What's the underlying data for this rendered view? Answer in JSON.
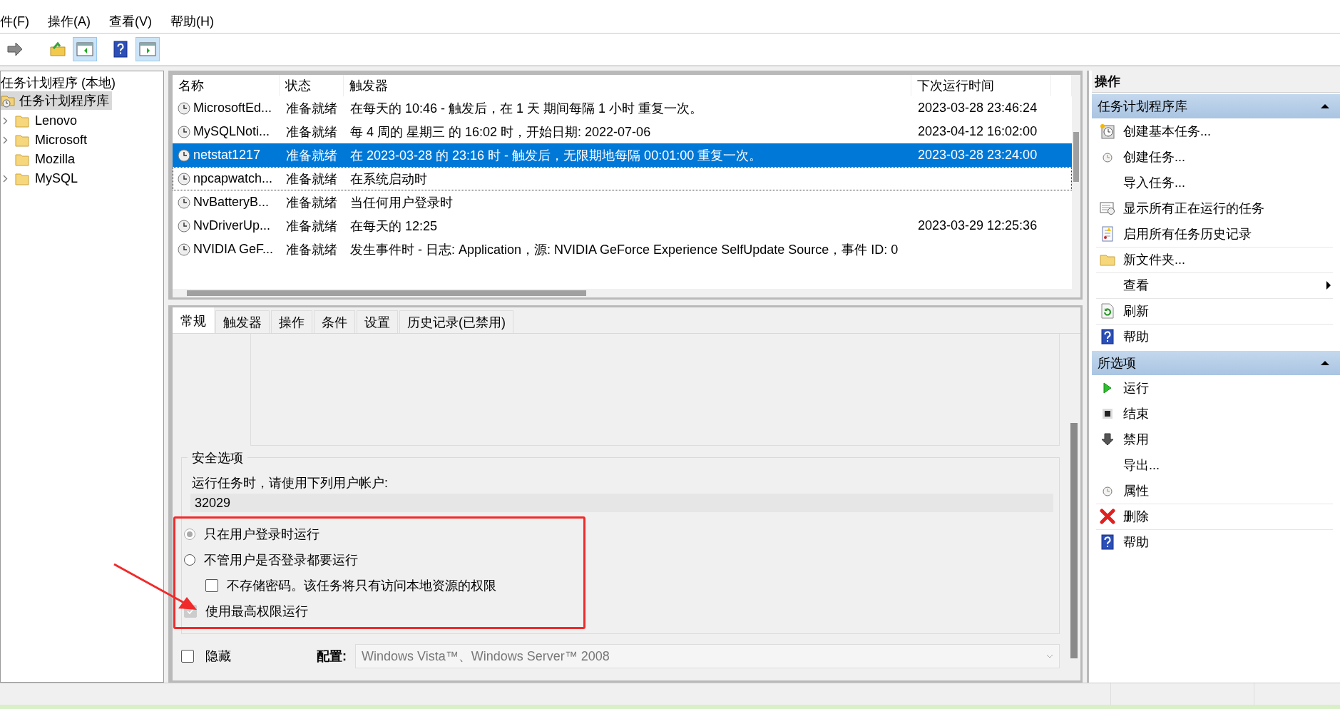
{
  "menu": [
    "件(F)",
    "操作(A)",
    "查看(V)",
    "帮助(H)"
  ],
  "toolbar": [
    {
      "kind": "forward",
      "selected": false
    },
    {
      "kind": "folder-up",
      "selected": false
    },
    {
      "kind": "pane-left",
      "selected": true
    },
    {
      "kind": "help",
      "selected": false
    },
    {
      "kind": "pane-right",
      "selected": true
    }
  ],
  "tree": {
    "root": "任务计划程序 (本地)",
    "library": {
      "label": "任务计划程序库",
      "selected": true
    },
    "children": [
      {
        "label": "Lenovo",
        "expandable": true
      },
      {
        "label": "Microsoft",
        "expandable": true
      },
      {
        "label": "Mozilla",
        "expandable": false
      },
      {
        "label": "MySQL",
        "expandable": true
      }
    ]
  },
  "table": {
    "columns": [
      "名称",
      "状态",
      "触发器",
      "下次运行时间"
    ],
    "rows": [
      {
        "name": "MicrosoftEd...",
        "status": "准备就绪",
        "trigger": "在每天的 10:46 - 触发后，在 1 天 期间每隔 1 小时 重复一次。",
        "next": "2023-03-28 23:46:24",
        "selected": false,
        "focused": false
      },
      {
        "name": "MySQLNoti...",
        "status": "准备就绪",
        "trigger": "每 4 周的 星期三 的 16:02 时，开始日期: 2022-07-06",
        "next": "2023-04-12 16:02:00",
        "selected": false,
        "focused": false
      },
      {
        "name": "netstat1217",
        "status": "准备就绪",
        "trigger": "在 2023-03-28 的 23:16 时 - 触发后，无限期地每隔 00:01:00 重复一次。",
        "next": "2023-03-28 23:24:00",
        "selected": true,
        "focused": false
      },
      {
        "name": "npcapwatch...",
        "status": "准备就绪",
        "trigger": "在系统启动时",
        "next": "",
        "selected": false,
        "focused": true
      },
      {
        "name": "NvBatteryB...",
        "status": "准备就绪",
        "trigger": "当任何用户登录时",
        "next": "",
        "selected": false,
        "focused": false
      },
      {
        "name": "NvDriverUp...",
        "status": "准备就绪",
        "trigger": "在每天的 12:25",
        "next": "2023-03-29 12:25:36",
        "selected": false,
        "focused": false
      },
      {
        "name": "NVIDIA GeF...",
        "status": "准备就绪",
        "trigger": "发生事件时 - 日志: Application，源: NVIDIA GeForce Experience SelfUpdate Source，事件 ID: 0",
        "next": "",
        "selected": false,
        "focused": false
      }
    ]
  },
  "detail": {
    "tabs": [
      {
        "label": "常规",
        "selected": true
      },
      {
        "label": "触发器",
        "selected": false
      },
      {
        "label": "操作",
        "selected": false
      },
      {
        "label": "条件",
        "selected": false
      },
      {
        "label": "设置",
        "selected": false
      },
      {
        "label": "历史记录(已禁用)",
        "selected": false
      }
    ],
    "security": {
      "title": "安全选项",
      "account_label": "运行任务时，请使用下列用户帐户:",
      "account": "32029",
      "options": [
        {
          "kind": "radio",
          "label": "只在用户登录时运行",
          "checked": true,
          "disabled": true,
          "indented": false
        },
        {
          "kind": "radio",
          "label": "不管用户是否登录都要运行",
          "checked": false,
          "disabled": false,
          "indented": false
        },
        {
          "kind": "checkbox",
          "label": "不存储密码。该任务将只有访问本地资源的权限",
          "checked": false,
          "disabled": false,
          "indented": true
        },
        {
          "kind": "checkbox",
          "label": "使用最高权限运行",
          "checked": true,
          "disabled": true,
          "indented": false
        }
      ]
    },
    "hidden": {
      "label": "隐藏",
      "checked": false
    },
    "config": {
      "label": "配置:",
      "value": "Windows Vista™、Windows Server™ 2008"
    }
  },
  "annotation": {
    "highlight_options": true,
    "arrow": true
  },
  "actions": {
    "title": "操作",
    "sections": [
      {
        "title": "任务计划程序库",
        "items": [
          {
            "label": "创建基本任务...",
            "kind": "clock-new",
            "rule": false,
            "submenu": false
          },
          {
            "label": "创建任务...",
            "kind": "clock",
            "rule": false,
            "submenu": false
          },
          {
            "label": "导入任务...",
            "kind": "plain",
            "rule": false,
            "submenu": false
          },
          {
            "label": "显示所有正在运行的任务",
            "kind": "list",
            "rule": false,
            "submenu": false
          },
          {
            "label": "启用所有任务历史记录",
            "kind": "log",
            "rule": false,
            "submenu": false
          },
          {
            "label": "新文件夹...",
            "kind": "folder",
            "rule": true,
            "submenu": false
          },
          {
            "label": "查看",
            "kind": "plain",
            "rule": true,
            "submenu": true
          },
          {
            "label": "刷新",
            "kind": "refresh",
            "rule": true,
            "submenu": false
          },
          {
            "label": "帮助",
            "kind": "help",
            "rule": true,
            "submenu": false
          }
        ]
      },
      {
        "title": "所选项",
        "items": [
          {
            "label": "运行",
            "kind": "play",
            "rule": false,
            "submenu": false
          },
          {
            "label": "结束",
            "kind": "stop",
            "rule": false,
            "submenu": false
          },
          {
            "label": "禁用",
            "kind": "down",
            "rule": false,
            "submenu": false
          },
          {
            "label": "导出...",
            "kind": "plain",
            "rule": false,
            "submenu": false
          },
          {
            "label": "属性",
            "kind": "clock",
            "rule": false,
            "submenu": false
          },
          {
            "label": "删除",
            "kind": "delete",
            "rule": true,
            "submenu": false
          },
          {
            "label": "帮助",
            "kind": "help",
            "rule": true,
            "submenu": false
          }
        ]
      }
    ]
  }
}
